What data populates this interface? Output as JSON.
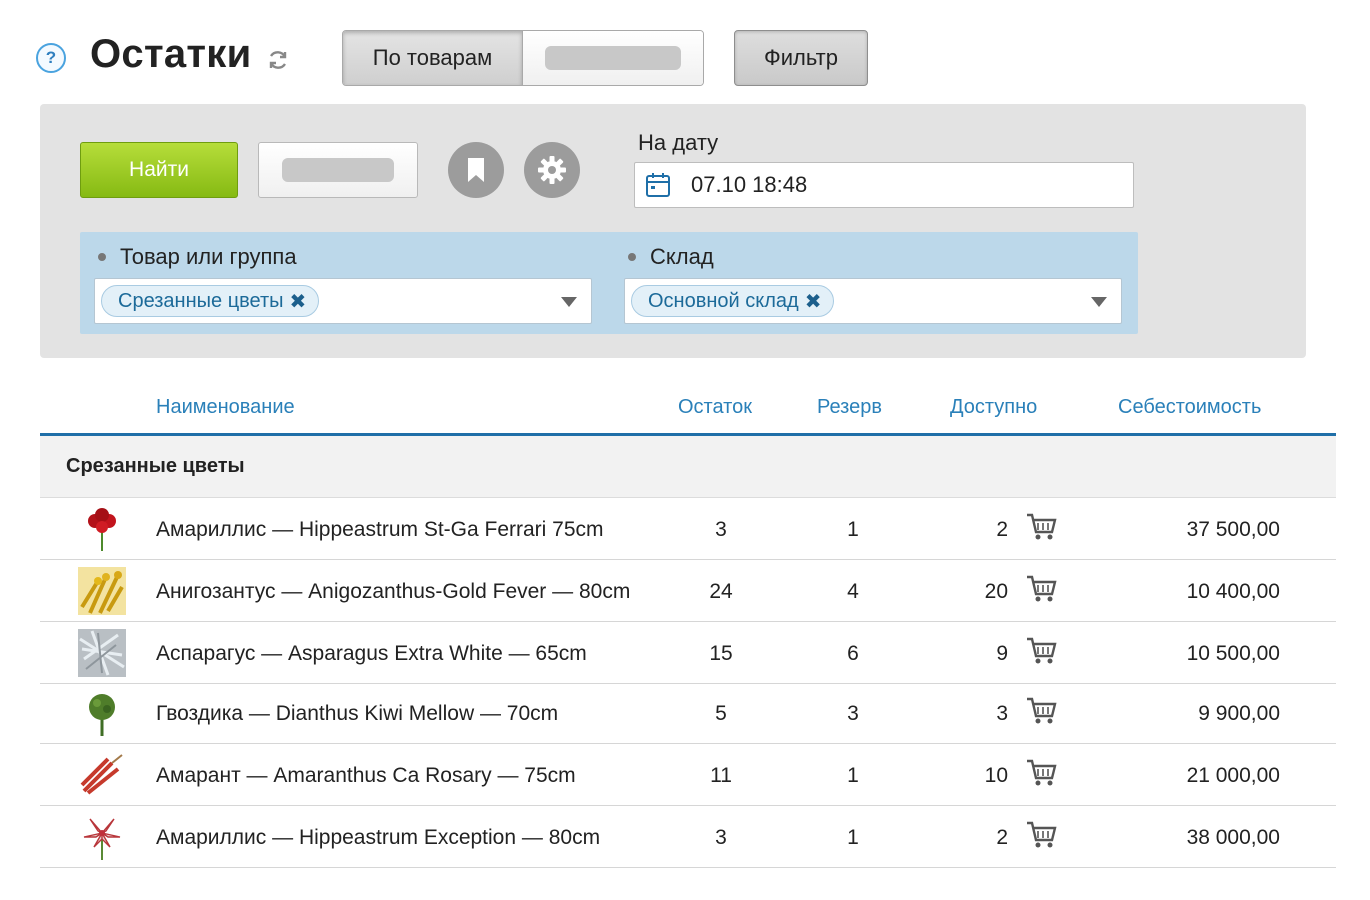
{
  "header": {
    "title": "Остатки",
    "view_tabs": [
      {
        "label": "По товарам",
        "active": true
      },
      {
        "label": "",
        "active": false
      }
    ],
    "filter_button": "Фильтр"
  },
  "filter_panel": {
    "find_button": "Найти",
    "date_label": "На дату",
    "date_value": "07.10 18:48",
    "conditions": [
      {
        "label": "Товар или группа",
        "chip": "Срезанные цветы"
      },
      {
        "label": "Склад",
        "chip": "Основной склад"
      }
    ]
  },
  "table": {
    "columns": [
      "Наименование",
      "Остаток",
      "Резерв",
      "Доступно",
      "Себестоимость"
    ],
    "group": "Срезанные цветы",
    "rows": [
      {
        "name": "Амариллис — Hippeastrum St-Ga Ferrari 75cm",
        "qty": "3",
        "reserve": "1",
        "available": "2",
        "cost": "37 500,00",
        "thumb": "red-amaryllis"
      },
      {
        "name": "Анигозантус — Anigozanthus-Gold Fever — 80cm",
        "qty": "24",
        "reserve": "4",
        "available": "20",
        "cost": "10 400,00",
        "thumb": "yellow-kangaroo-paw"
      },
      {
        "name": "Аспарагус —  Asparagus Extra White — 65cm",
        "qty": "15",
        "reserve": "6",
        "available": "9",
        "cost": "10 500,00",
        "thumb": "white-asparagus"
      },
      {
        "name": "Гвоздика — Dianthus Kiwi Mellow — 70cm",
        "qty": "5",
        "reserve": "3",
        "available": "3",
        "cost": "9 900,00",
        "thumb": "green-dianthus"
      },
      {
        "name": "Амарант — Amaranthus Ca Rosary — 75cm",
        "qty": "11",
        "reserve": "1",
        "available": "10",
        "cost": "21 000,00",
        "thumb": "red-amaranthus"
      },
      {
        "name": "Амариллис — Hippeastrum Exception — 80cm",
        "qty": "3",
        "reserve": "1",
        "available": "2",
        "cost": "38 000,00",
        "thumb": "striped-amaryllis"
      }
    ]
  },
  "colors": {
    "accent": "#2a80b9",
    "find_button": "#97c622",
    "panel": "#e3e3e3",
    "conditions_bg": "#bcd8ea"
  },
  "icons": {
    "help": "help-icon",
    "refresh": "refresh-icon",
    "bookmark": "bookmark-icon",
    "settings": "gear-icon",
    "calendar": "calendar-icon",
    "cart": "cart-icon"
  }
}
